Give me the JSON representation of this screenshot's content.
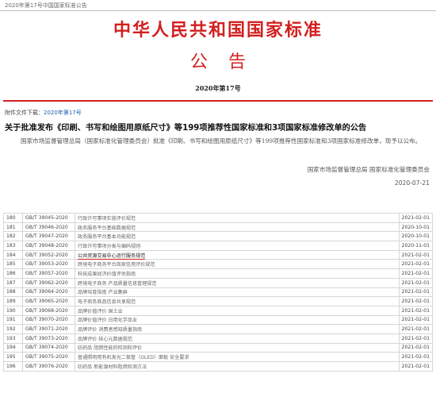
{
  "header": {
    "tab_title": "2020年第17号中国国家标准公告",
    "std_title": "中华人民共和国国家标准",
    "announce": "公告",
    "doc_number": "2020年第17号"
  },
  "attachment": {
    "label": "附件文件下载：",
    "link": "2020年第17号"
  },
  "article": {
    "headline": "关于批准发布《印刷、书写和绘图用原纸尺寸》等199项推荐性国家标准和3项国家标准修改单的公告",
    "body": "国家市场监督管理总局（国家标准化管理委员会）批准《印刷、书写和绘图用原纸尺寸》等199项推荐性国家标准和3项国家标准修改单，现予以公布。",
    "signer": "国家市场监督管理总局 国家标准化管理委员会",
    "date": "2020-07-21"
  },
  "table": {
    "rows": [
      {
        "no": "180",
        "code": "GB/T 39045-2020",
        "name": "行政许可事项实施评价规范",
        "date": "2021-02-01"
      },
      {
        "no": "181",
        "code": "GB/T 39046-2020",
        "name": "政务服务平台基础数据规范",
        "date": "2020-10-01"
      },
      {
        "no": "182",
        "code": "GB/T 39047-2020",
        "name": "政务服务平台基本功能规范",
        "date": "2020-10-01"
      },
      {
        "no": "183",
        "code": "GB/T 39048-2020",
        "name": "行政许可事项分类与编码规则",
        "date": "2020-11-01"
      },
      {
        "no": "184",
        "code": "GB/T 39052-2020",
        "name": "公共资源交易中心运行服务规范",
        "date": "2021-02-01",
        "highlight": true
      },
      {
        "no": "185",
        "code": "GB/T 39053-2020",
        "name": "跨境电子商务平台商家信用评价规范",
        "date": "2021-02-01"
      },
      {
        "no": "186",
        "code": "GB/T 39057-2020",
        "name": "科技成果经济价值评估指南",
        "date": "2021-02-01"
      },
      {
        "no": "187",
        "code": "GB/T 39062-2020",
        "name": "跨境电子商务 产品质量信息管理规范",
        "date": "2021-02-01"
      },
      {
        "no": "188",
        "code": "GB/T 39064-2020",
        "name": "品牌培育指南 产业集群",
        "date": "2021-02-01"
      },
      {
        "no": "189",
        "code": "GB/T 39065-2020",
        "name": "电子商务商品信息共享规范",
        "date": "2021-02-01"
      },
      {
        "no": "190",
        "code": "GB/T 39068-2020",
        "name": "品牌价值评价 国土业",
        "date": "2021-02-01"
      },
      {
        "no": "191",
        "code": "GB/T 39070-2020",
        "name": "品牌价值评价 日用化学品业",
        "date": "2021-02-01"
      },
      {
        "no": "192",
        "code": "GB/T 39071-2020",
        "name": "品牌评价 消费者感知质量指南",
        "date": "2021-02-01"
      },
      {
        "no": "193",
        "code": "GB/T 39073-2020",
        "name": "品牌评价 核心元数据规范",
        "date": "2021-02-01"
      },
      {
        "no": "194",
        "code": "GB/T 39074-2020",
        "name": "纺织品 阻燃性能的检测和评价",
        "date": "2021-02-01"
      },
      {
        "no": "195",
        "code": "GB/T 39075-2020",
        "name": "普通照明用有机发光二极管（OLED）面板 安全要求",
        "date": "2021-02-01"
      },
      {
        "no": "196",
        "code": "GB/T 39076-2020",
        "name": "纺织品 新能源材料阻燃检测方法",
        "date": "2021-02-01"
      }
    ]
  }
}
